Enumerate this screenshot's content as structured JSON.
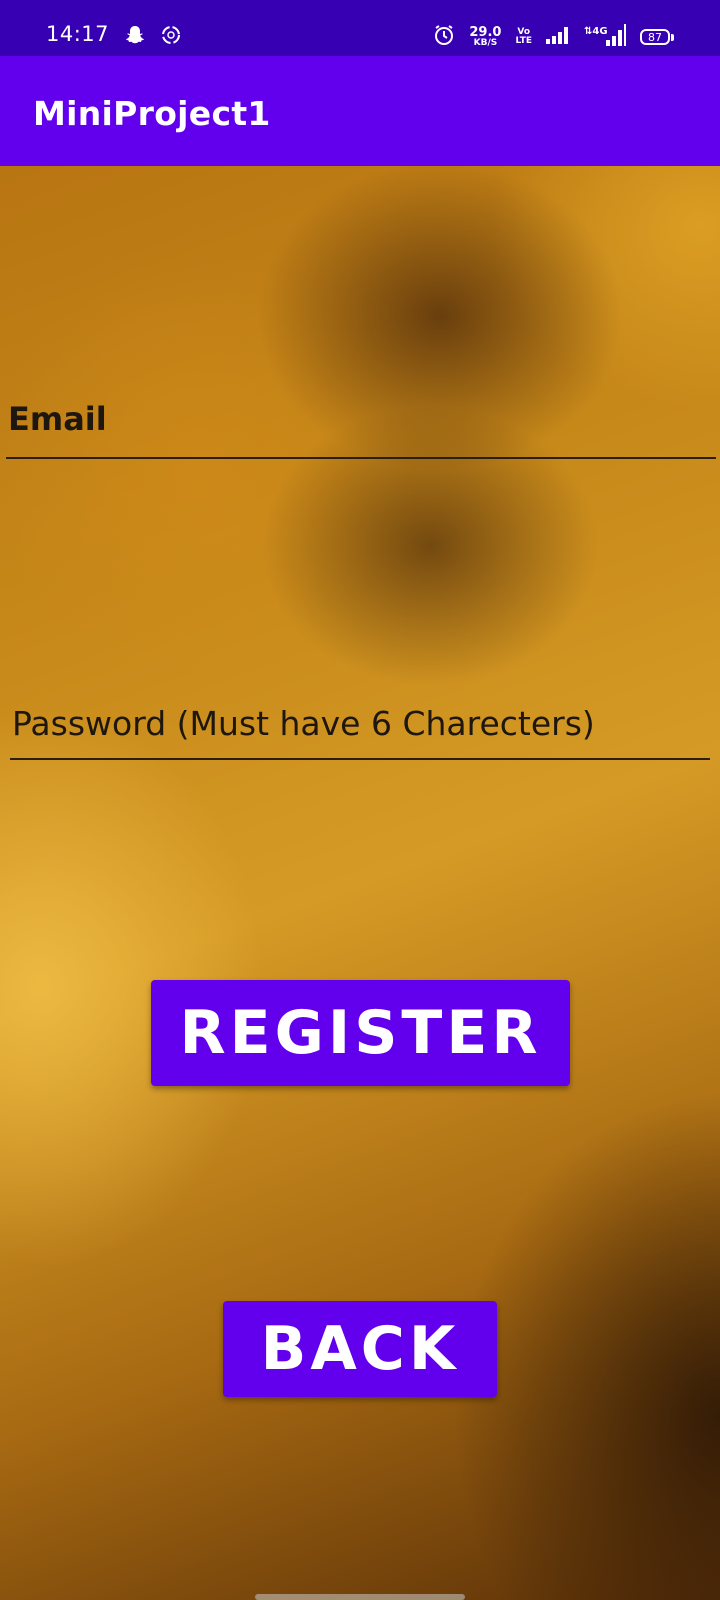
{
  "status_bar": {
    "time": "14:17",
    "icons": [
      "snapchat-icon",
      "sync-icon",
      "alarm-icon",
      "signal-icon",
      "signal-4g-icon",
      "battery-icon"
    ],
    "net_speed_value": "29.0",
    "net_speed_unit": "KB/S",
    "volte_top": "Vo",
    "volte_bottom": "LTE",
    "battery_level": "87"
  },
  "app_bar": {
    "title": "MiniProject1",
    "color": "#6200ee"
  },
  "form": {
    "email": {
      "value": "Email"
    },
    "password": {
      "placeholder": "Password (Must have 6 Charecters)"
    }
  },
  "buttons": {
    "register_label": "REGISTER",
    "back_label": "BACK",
    "color": "#6200ee"
  }
}
